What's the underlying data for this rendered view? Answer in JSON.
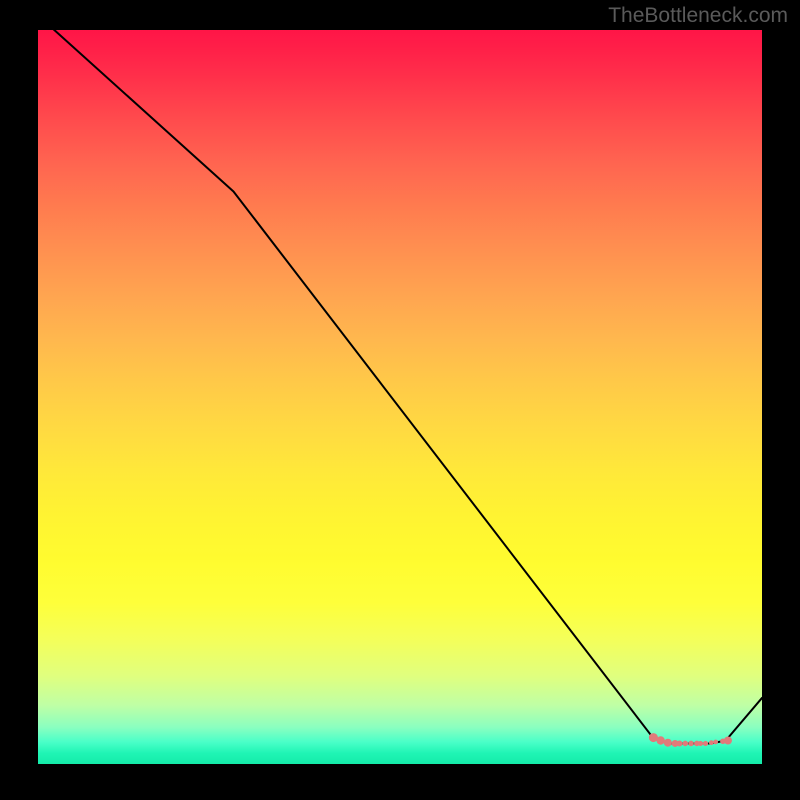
{
  "watermark": "TheBottleneck.com",
  "chart_data": {
    "type": "line",
    "title": "",
    "xlabel": "",
    "ylabel": "",
    "xlim": [
      0,
      100
    ],
    "ylim": [
      0,
      100
    ],
    "series": [
      {
        "name": "curve",
        "color": "#000000",
        "stroke_width": 2,
        "x": [
          0,
          27,
          85,
          87,
          93,
          95,
          100
        ],
        "y": [
          102,
          78,
          3.5,
          2.8,
          2.8,
          3.2,
          9
        ]
      }
    ],
    "markers": {
      "name": "highlight-segment",
      "color": "#e17a7a",
      "points_x": [
        85,
        86,
        87,
        88,
        88.6,
        89.4,
        90.2,
        91,
        91.5,
        92.2,
        93,
        93.6,
        94.6,
        95.3
      ],
      "points_y": [
        3.6,
        3.2,
        2.9,
        2.8,
        2.8,
        2.8,
        2.8,
        2.8,
        2.8,
        2.8,
        2.9,
        3.0,
        3.1,
        3.2
      ],
      "radii": [
        4.5,
        4.2,
        4.0,
        3.5,
        3.0,
        2.8,
        2.8,
        2.8,
        2.6,
        2.6,
        2.4,
        2.4,
        2.8,
        4.0
      ]
    },
    "background_gradient": {
      "orientation": "vertical",
      "stops": [
        {
          "pos": 0.0,
          "color": "#ff1547"
        },
        {
          "pos": 0.5,
          "color": "#ffd942"
        },
        {
          "pos": 0.78,
          "color": "#feff3a"
        },
        {
          "pos": 1.0,
          "color": "#14eba9"
        }
      ]
    }
  }
}
